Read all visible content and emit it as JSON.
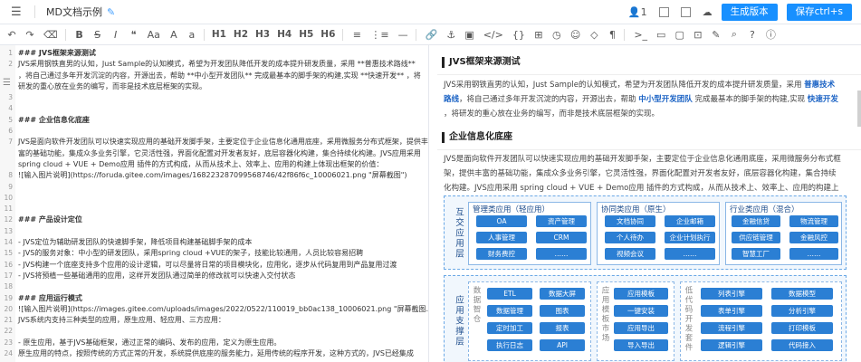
{
  "header": {
    "menu_icon": "menu-icon",
    "title": "MD文档示例",
    "edit_icon": "pencil-icon",
    "user_count": "1",
    "build_label": "生成版本",
    "save_label": "保存ctrl+s",
    "brand_color": "#1890ff"
  },
  "toolbar": {
    "undo": "↶",
    "redo": "↷",
    "clear": "⌫",
    "bold": "B",
    "strike": "S",
    "italic": "I",
    "quote": "❝",
    "font_size": "Aa",
    "upper": "A",
    "lower": "a",
    "h1": "H1",
    "h2": "H2",
    "h3": "H3",
    "h4": "H4",
    "h5": "H5",
    "h6": "H6",
    "ul": "≡",
    "ol": "⋮≡",
    "hr": "—",
    "link": "🔗",
    "anchor": "⚓",
    "image": "▣",
    "code": "</>",
    "code_block": "{}",
    "time": "◷",
    "emoji": "☺",
    "html": "◇",
    "pagebreak": "¶",
    "terminal": ">_",
    "preview": "▭",
    "watch": "▢",
    "fullscreen": "⊡",
    "clear_all": "✎",
    "search": "⌕",
    "help": "?",
    "info": "ⓘ"
  },
  "editor": {
    "lines": [
      {
        "n": "1",
        "text": "### JVS框架来源测试",
        "cls": "c-h"
      },
      {
        "n": "2",
        "text": "JVS采用钢铁直男的认知，Just Sample的认知模式，希望为开发团队降低开发的成本提升研发质量，采用 **普惠技术路线**",
        "cls": ""
      },
      {
        "n": "",
        "text": "，将自己通过多年开发沉淀的内容，开源出去，帮助 **中小型开发团队** 完成最基本的脚手架的构建,实现 **快速开发** ，将",
        "cls": ""
      },
      {
        "n": "",
        "text": "研发的重心放在业务的编写，而非是技术底层框架的实现。",
        "cls": ""
      },
      {
        "n": "3",
        "text": "",
        "cls": ""
      },
      {
        "n": "4",
        "text": "",
        "cls": ""
      },
      {
        "n": "5",
        "text": "### 企业信息化底座",
        "cls": "c-h"
      },
      {
        "n": "6",
        "text": "",
        "cls": ""
      },
      {
        "n": "7",
        "text": "JVS是面向软件开发团队可以快速实现应用的基础开发脚手架，主要定位于企业信息化通用底座，采用微服务分布式框架，提供丰",
        "cls": ""
      },
      {
        "n": "",
        "text": "富的基础功能，集成众多业务引擎，它灵活性强，界面化配置对开发者友好，底层容器化构建，集合持续化构建。JVS应用采用",
        "cls": ""
      },
      {
        "n": "",
        "text": "spring cloud + VUE + Demo应用 插件的方式构成，从而从技术上、效率上、应用的构建上体现出框架的价值：",
        "cls": ""
      },
      {
        "n": "8",
        "text": "![输入图片说明](https://foruda.gitee.com/images/1682232870995687​46/42f86f6c_10006021.png \"屏幕截图\")",
        "cls": "c-link"
      },
      {
        "n": "9",
        "text": "",
        "cls": ""
      },
      {
        "n": "10",
        "text": "",
        "cls": ""
      },
      {
        "n": "11",
        "text": "",
        "cls": ""
      },
      {
        "n": "12",
        "text": "### 产品设计定位",
        "cls": "c-h"
      },
      {
        "n": "13",
        "text": "",
        "cls": ""
      },
      {
        "n": "14",
        "text": "- JVS定位为辅助研发团队的快速脚手架，降低项目构建基础脚手架的成本",
        "cls": "c-list"
      },
      {
        "n": "15",
        "text": "- JVS的服务对象：中小型的研发团队，采用spring cloud +VUE的架子，技能比较通用，人员比较容易招聘",
        "cls": "c-list"
      },
      {
        "n": "16",
        "text": "- JVS构建一个底座支持多个应用的设计逻辑，可以尽量将日常的项目模块化，应用化，逐步从代码复用到产品复用过渡",
        "cls": "c-list"
      },
      {
        "n": "17",
        "text": "- JVS将预植一些基础通用的应用，这样开发团队通过简单的修改就可以快速入交付状态",
        "cls": "c-list"
      },
      {
        "n": "18",
        "text": "",
        "cls": ""
      },
      {
        "n": "19",
        "text": "### 应用运行模式",
        "cls": "c-h"
      },
      {
        "n": "20",
        "text": "![输入图片说明](https://images.gitee.com/uploads/images/2022/0522/110019_bb0ac138_10006021.png \"屏幕截图.png\")",
        "cls": "c-link"
      },
      {
        "n": "21",
        "text": "JVS系统内支持三种类型的应用，原生应用、轻应用、三方应用：",
        "cls": ""
      },
      {
        "n": "22",
        "text": "",
        "cls": ""
      },
      {
        "n": "23",
        "text": "- 原生应用，基于JVS基础框架，通过正常的编码、发布的应用，定义为原生应用。",
        "cls": "c-list"
      },
      {
        "n": "24",
        "text": "原生应用的特点，按照传统的方式正常的开发，系统提供底座的服务能力，延用传统的程序开发，这种方式的，JVS已经集成",
        "cls": ""
      }
    ]
  },
  "preview": {
    "h_source": "JVS框架来源测试",
    "p1_a": "JVS采用钢铁直男的认知，Just Sample的认知模式，希望为开发团队降低开发的成本提升研发质量，采用",
    "p1_b1": "普惠技术路线",
    "p1_c": "，将自己通过多年开发沉淀的内容，开源出去，帮助",
    "p1_b2": "中小型开发团队",
    "p1_d": "完成最基本的脚手架的构建,实现",
    "p1_b3": "快速开发",
    "p1_e": "，将研发的重心放在业务的编写，而非是技术底层框架的实现。",
    "h_base": "企业信息化底座",
    "p2": "JVS是面向软件开发团队可以快速实现应用的基础开发脚手架，主要定位于企业信息化通用底座，采用微服务分布式框架，提供丰富的基础功能，集成众多业务引擎，它灵活性强，界面化配置对开发者友好，底层容器化构建，集合持续化构建。JVS应用采用 spring cloud + VUE + Demo应用 插件的方式构成，从而从技术上、效率上、应用的构建上体现出框架的价值：",
    "diagram": {
      "row1_label": "互交应用层",
      "row2_label": "应用支撑层",
      "group_light": "管理类应用（轻应用）",
      "group_native": "协同类应用（原生）",
      "group_industry": "行业类应用（混合）",
      "light_chips": [
        "OA",
        "资产管理",
        "人事管理",
        "CRM",
        "财务费控",
        "……"
      ],
      "native_chips": [
        "文档协同",
        "企业邮箱",
        "个人待办",
        "企业计划执行",
        "视频会议",
        "……"
      ],
      "industry_chips": [
        "金融信贷",
        "物流管理",
        "供应链管理",
        "金融风控",
        "智慧工厂",
        "……"
      ],
      "data_label": "数据智仓",
      "data_chips": [
        "ETL",
        "数据大屏",
        "数据管理",
        "图表",
        "定时加工",
        "报表",
        "执行日志",
        "API"
      ],
      "market_label": "应用模板市场",
      "market_chips": [
        "应用模板",
        "一键安装",
        "应用导出",
        "导入导出"
      ],
      "lowcode_label": "低代码开发套件",
      "lowcode_chips": [
        "列表引擎",
        "数据模型",
        "表单引擎",
        "分析引擎",
        "流程引擎",
        "打印模板",
        "逻辑引擎",
        "代码接入"
      ]
    }
  }
}
